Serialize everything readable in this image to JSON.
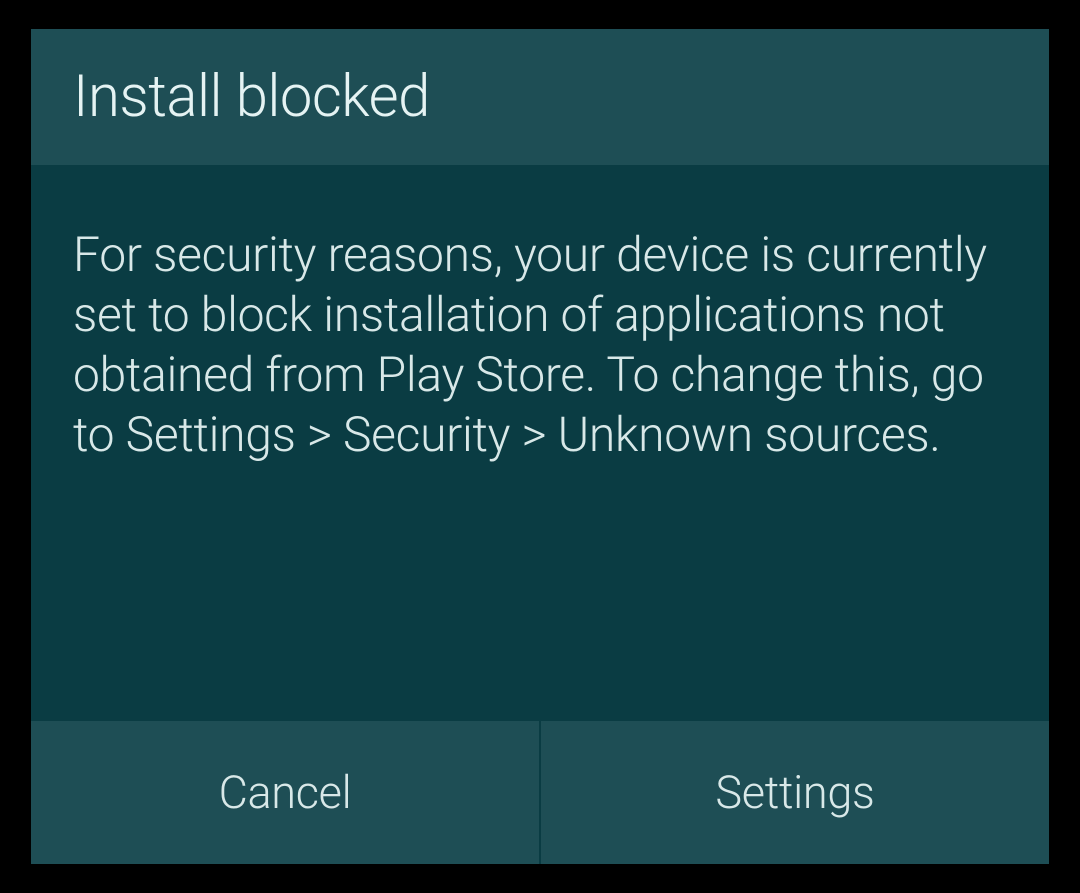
{
  "dialog": {
    "title": "Install blocked",
    "message": "For security reasons, your device is currently set to block installation of applications not obtained from Play Store. To change this, go to Settings > Security > Unknown sources.",
    "buttons": {
      "cancel": "Cancel",
      "settings": "Settings"
    }
  }
}
